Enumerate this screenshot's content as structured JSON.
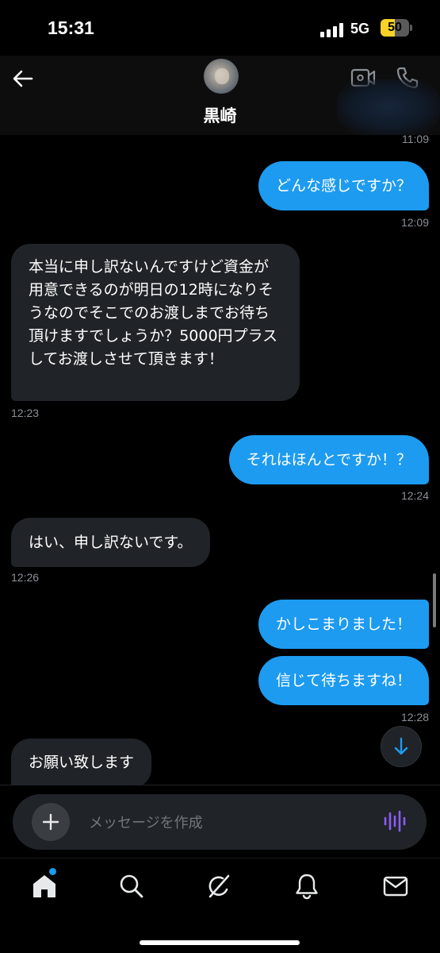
{
  "status_bar": {
    "time": "15:31",
    "network": "5G",
    "battery": "50",
    "battery_level": 0.5,
    "battery_color": "#f7d32a"
  },
  "header": {
    "contact_name": "黒崎",
    "icons": [
      "back-arrow-icon",
      "video-camera-icon",
      "phone-icon"
    ]
  },
  "messages": [
    {
      "direction": "timestamp",
      "time": "11:09"
    },
    {
      "direction": "out",
      "text": "どんな感じですか？",
      "time": "12:09"
    },
    {
      "direction": "in",
      "text": "本当に申し訳ないんですけど資金が用意できるのが明日の12時になりそうなのでそこでのお渡しまでお待ち頂けますでしょうか？5000円プラスしてお渡しさせて頂きます！",
      "time": "12:23"
    },
    {
      "direction": "out",
      "text": "それはほんとですか！？",
      "time": "12:24"
    },
    {
      "direction": "in",
      "text": "はい、申し訳ないです。",
      "time": "12:26"
    },
    {
      "direction": "out",
      "text": "かしこまりました！"
    },
    {
      "direction": "out",
      "text": "信じて待ちますね！",
      "time": "12:28"
    },
    {
      "direction": "in",
      "text": "お願い致します"
    }
  ],
  "composer": {
    "placeholder": "メッセージを作成"
  },
  "tab_bar": {
    "items": [
      "home-icon",
      "search-icon",
      "grok-icon",
      "notifications-icon",
      "messages-icon"
    ],
    "active": "home-icon",
    "badge_color": "#1d9bf0"
  },
  "colors": {
    "outgoing_bubble": "#1d9bf0",
    "incoming_bubble": "#202327",
    "background": "#000000"
  }
}
